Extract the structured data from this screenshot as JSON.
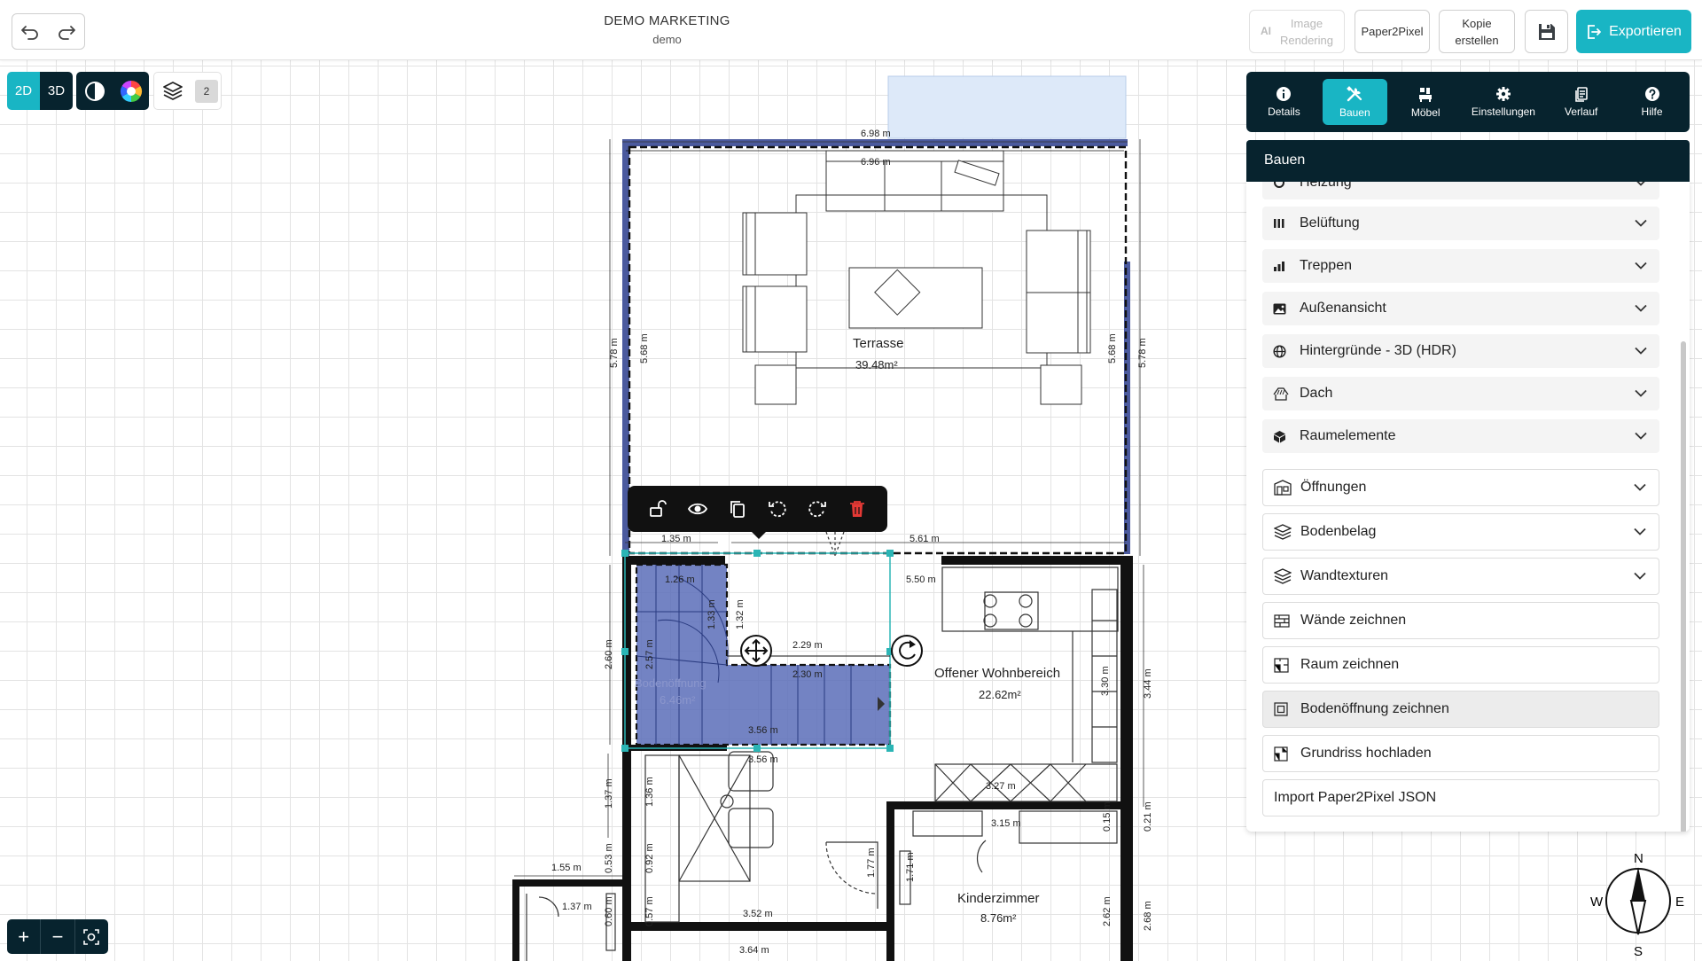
{
  "project": {
    "title": "DEMO MARKETING",
    "subtitle": "demo"
  },
  "topbar": {
    "ai_badge": "AI",
    "image_rendering_line1": "Image",
    "image_rendering_line2": "Rendering",
    "paper2pixel": "Paper2Pixel",
    "copy_line1": "Kopie",
    "copy_line2": "erstellen",
    "export": "Exportieren"
  },
  "modes": {
    "two_d": "2D",
    "three_d": "3D",
    "layer_count": "2"
  },
  "tabs": [
    {
      "label": "Details",
      "icon": "info-icon"
    },
    {
      "label": "Bauen",
      "icon": "tools-icon"
    },
    {
      "label": "Möbel",
      "icon": "furniture-icon"
    },
    {
      "label": "Einstellungen",
      "icon": "gear-icon"
    },
    {
      "label": "Verlauf",
      "icon": "history-icon"
    },
    {
      "label": "Hilfe",
      "icon": "help-icon"
    }
  ],
  "panel": {
    "title": "Bauen",
    "items": [
      {
        "label": "Heizung",
        "icon": "heating-icon"
      },
      {
        "label": "Belüftung",
        "icon": "ventilation-icon"
      },
      {
        "label": "Treppen",
        "icon": "stairs-icon"
      },
      {
        "label": "Außenansicht",
        "icon": "image-icon"
      },
      {
        "label": "Hintergründe - 3D (HDR)",
        "icon": "globe-icon"
      },
      {
        "label": "Dach",
        "icon": "roof-icon"
      },
      {
        "label": "Raumelemente",
        "icon": "cube-icon"
      },
      {
        "label": "Öffnungen",
        "icon": "openings-icon"
      },
      {
        "label": "Bodenbelag",
        "icon": "floor-layers-icon"
      },
      {
        "label": "Wandtexturen",
        "icon": "wall-layers-icon"
      },
      {
        "label": "Wände zeichnen",
        "icon": "wall-draw-icon"
      },
      {
        "label": "Raum zeichnen",
        "icon": "room-draw-icon"
      },
      {
        "label": "Bodenöffnung zeichnen",
        "icon": "floor-opening-icon"
      },
      {
        "label": "Grundriss hochladen",
        "icon": "upload-plan-icon"
      },
      {
        "label": "Import Paper2Pixel JSON",
        "icon": ""
      }
    ]
  },
  "rooms": {
    "terrasse": {
      "name": "Terrasse",
      "area": "39.48m²"
    },
    "wohnbereich": {
      "name": "Offener Wohnbereich",
      "area": "22.62m²"
    },
    "bodenoeffnung": {
      "name": "Bodenöffnung",
      "area": "6.46m²"
    },
    "kinderzimmer": {
      "name": "Kinderzimmer",
      "area": "8.76m²"
    }
  },
  "dimensions": {
    "d698": "6.98 m",
    "d696": "6.96 m",
    "d578": "5.78 m",
    "d568": "5.68 m",
    "d135": "1.35 m",
    "d561": "5.61 m",
    "d550": "5.50 m",
    "d126": "1.26 m",
    "d133": "1.33 m",
    "d132": "1.32 m",
    "d229": "2.29 m",
    "d230": "2.30 m",
    "d260": "2.60 m",
    "d257": "2.57 m",
    "d356": "3.56 m",
    "d330": "3.30 m",
    "d344": "3.44 m",
    "d327": "3.27 m",
    "d315": "3.15 m",
    "d015": "0.15 m",
    "d021": "0.21 m",
    "d137": "1.37 m",
    "d136": "1.36 m",
    "d155": "1.55 m",
    "d053": "0.53 m",
    "d092": "0.92 m",
    "d177": "1.77 m",
    "d171": "1.71 m",
    "d262": "2.62 m",
    "d268": "2.68 m",
    "d352": "3.52 m",
    "d364": "3.64 m",
    "d057": "0.57 m",
    "d060": "0.60 m",
    "d356b": "3.56 m"
  },
  "compass": {
    "n": "N",
    "s": "S",
    "e": "E",
    "w": "W"
  },
  "zoom": {
    "in": "+",
    "out": "−"
  },
  "colors": {
    "accent": "#19b5c4",
    "dark": "#07232e",
    "selection": "#5b6db8",
    "terrace_wall": "#4b5a9e"
  }
}
